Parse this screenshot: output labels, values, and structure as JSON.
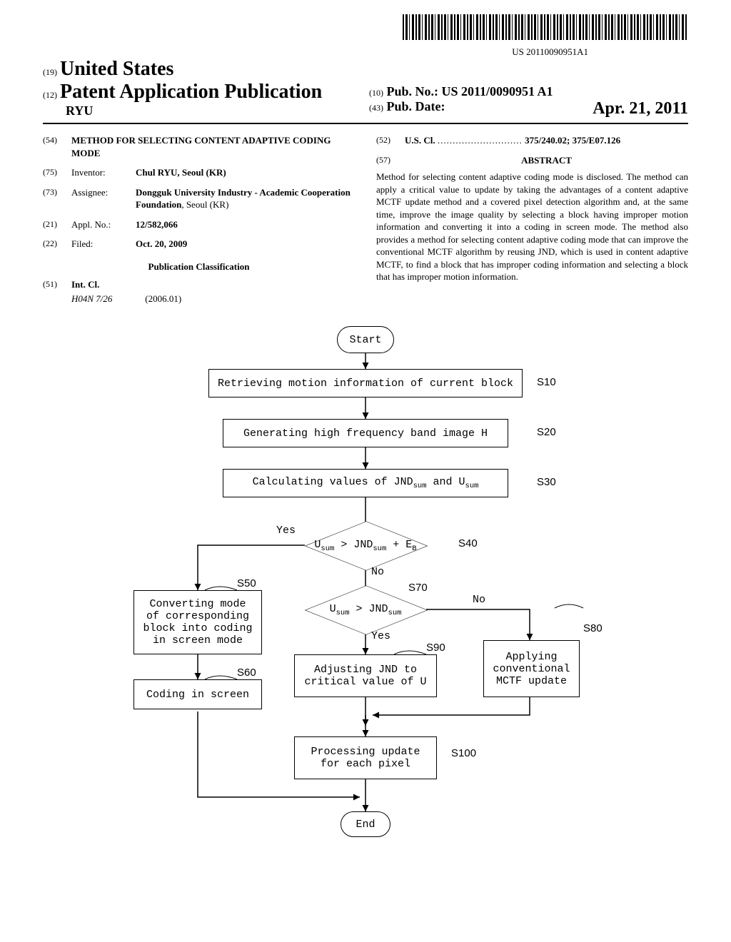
{
  "barcode_number": "US 20110090951A1",
  "header": {
    "code19": "(19)",
    "country": "United States",
    "code12": "(12)",
    "pub_type": "Patent Application Publication",
    "author_surname": "RYU",
    "code10": "(10)",
    "pubno_label": "Pub. No.:",
    "pubno_value": "US 2011/0090951 A1",
    "code43": "(43)",
    "pubdate_label": "Pub. Date:",
    "pubdate_value": "Apr. 21, 2011"
  },
  "biblio": {
    "c54": "(54)",
    "title": "METHOD FOR SELECTING CONTENT ADAPTIVE CODING MODE",
    "c75": "(75)",
    "inventor_label": "Inventor:",
    "inventor_value": "Chul RYU, Seoul (KR)",
    "c73": "(73)",
    "assignee_label": "Assignee:",
    "assignee_value_bold": "Dongguk University Industry - Academic Cooperation Foundation",
    "assignee_value_rest": ", Seoul (KR)",
    "c21": "(21)",
    "applno_label": "Appl. No.:",
    "applno_value": "12/582,066",
    "c22": "(22)",
    "filed_label": "Filed:",
    "filed_value": "Oct. 20, 2009",
    "pub_class_heading": "Publication Classification",
    "c51": "(51)",
    "intcl_label": "Int. Cl.",
    "intcl_code": "H04N 7/26",
    "intcl_year": "(2006.01)",
    "c52": "(52)",
    "uscl_label": "U.S. Cl.",
    "uscl_dots": "............................",
    "uscl_value": "375/240.02; 375/E07.126",
    "c57": "(57)",
    "abstract_heading": "ABSTRACT",
    "abstract_text": "Method for selecting content adaptive coding mode is disclosed. The method can apply a critical value to update by taking the advantages of a content adaptive MCTF update method and a covered pixel detection algorithm and, at the same time, improve the image quality by selecting a block having improper motion information and converting it into a coding in screen mode. The method also provides a method for selecting content adaptive coding mode that can improve the conventional MCTF algorithm by reusing JND, which is used in content adaptive MCTF, to find a block that has improper coding information and selecting a block that has improper motion information."
  },
  "flowchart": {
    "start": "Start",
    "end": "End",
    "s10": "Retrieving motion information of current block",
    "s20": "Generating high frequency band image H",
    "s30": "Calculating values of JNDsum and Usum",
    "s40_lhs": "Usum > JNDsum + E",
    "s40_sub": "B",
    "s50": "Converting mode of corresponding block into coding in screen mode",
    "s60": "Coding in screen",
    "s70": "Usum > JNDsum",
    "s80": "Applying conventional MCTF update",
    "s90": "Adjusting JND to critical value of U",
    "s100": "Processing update for each pixel",
    "yes": "Yes",
    "no": "No",
    "labels": {
      "s10": "S10",
      "s20": "S20",
      "s30": "S30",
      "s40": "S40",
      "s50": "S50",
      "s60": "S60",
      "s70": "S70",
      "s80": "S80",
      "s90": "S90",
      "s100": "S100"
    }
  }
}
